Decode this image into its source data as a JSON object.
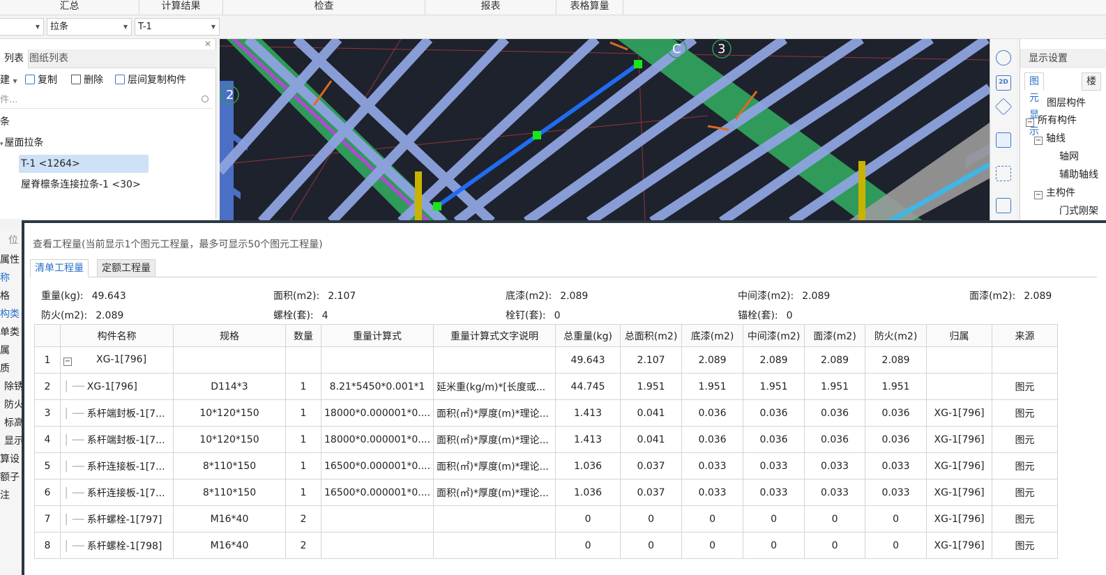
{
  "menubar": {
    "items": [
      "汇总",
      "计算结果",
      "检查",
      "报表",
      "表格算量"
    ]
  },
  "dropdowns": {
    "first": "",
    "second": "拉条",
    "third": "T-1"
  },
  "left_panel": {
    "tab_list": "列表",
    "tab_drawings": "图纸列表",
    "toolbar": {
      "new": "建",
      "copy": "复制",
      "delete": "删除",
      "floor_copy": "层间复制构件"
    },
    "search_placeholder": "件...",
    "tree": {
      "root": "条",
      "group": "屋面拉条",
      "item1": "T-1 <1264>",
      "item2": "屋脊檩条连接拉条-1 <30>"
    }
  },
  "viewport": {
    "axis_c": "C",
    "axis_3": "3",
    "axis_2": "2"
  },
  "display_panel": {
    "title": "显示设置",
    "tab_elements": "图元显示",
    "tab_floor": "楼",
    "tree": {
      "layer": "图层构件",
      "all": "所有构件",
      "axis": "轴线",
      "grid": "轴网",
      "aux": "辅助轴线",
      "main": "主构件",
      "frame": "门式刚架"
    }
  },
  "sidebar_labels": [
    "属性",
    "称",
    "格",
    "构类",
    "单类",
    "属",
    "质",
    "除锈",
    "防火",
    "标高",
    "显示",
    "算设",
    "额子",
    "注"
  ],
  "side_tab": "位",
  "dialog": {
    "title": "查看工程量(当前显示1个图元工程量，最多可显示50个图元工程量)",
    "tab_bill": "清单工程量",
    "tab_quota": "定额工程量",
    "summary": {
      "weight_label": "重量(kg):",
      "weight": "49.643",
      "area_label": "面积(m2):",
      "area": "2.107",
      "primer_label": "底漆(m2):",
      "primer": "2.089",
      "mid_label": "中间漆(m2):",
      "mid": "2.089",
      "top_label": "面漆(m2):",
      "top": "2.089",
      "fire_label": "防火(m2):",
      "fire": "2.089",
      "bolt_label": "螺栓(套):",
      "bolt": "4",
      "stud_label": "栓钉(套):",
      "stud": "0",
      "anchor_label": "锚栓(套):",
      "anchor": "0"
    },
    "table": {
      "headers": [
        "",
        "构件名称",
        "规格",
        "数量",
        "重量计算式",
        "重量计算式文字说明",
        "总重量(kg)",
        "总面积(m2)",
        "底漆(m2)",
        "中间漆(m2)",
        "面漆(m2)",
        "防火(m2)",
        "归属",
        "来源"
      ],
      "rows": [
        [
          "1",
          "XG-1[796]",
          "",
          "",
          "",
          "",
          "49.643",
          "2.107",
          "2.089",
          "2.089",
          "2.089",
          "2.089",
          "",
          ""
        ],
        [
          "2",
          "XG-1[796]",
          "D114*3",
          "1",
          "8.21*5450*0.001*1",
          "延米重(kg/m)*[长度或...",
          "44.745",
          "1.951",
          "1.951",
          "1.951",
          "1.951",
          "1.951",
          "",
          "图元"
        ],
        [
          "3",
          "系杆端封板-1[7...",
          "10*120*150",
          "1",
          "18000*0.000001*0....",
          "面积(㎡)*厚度(m)*理论...",
          "1.413",
          "0.041",
          "0.036",
          "0.036",
          "0.036",
          "0.036",
          "XG-1[796]",
          "图元"
        ],
        [
          "4",
          "系杆端封板-1[7...",
          "10*120*150",
          "1",
          "18000*0.000001*0....",
          "面积(㎡)*厚度(m)*理论...",
          "1.413",
          "0.041",
          "0.036",
          "0.036",
          "0.036",
          "0.036",
          "XG-1[796]",
          "图元"
        ],
        [
          "5",
          "系杆连接板-1[7...",
          "8*110*150",
          "1",
          "16500*0.000001*0....",
          "面积(㎡)*厚度(m)*理论...",
          "1.036",
          "0.037",
          "0.033",
          "0.033",
          "0.033",
          "0.033",
          "XG-1[796]",
          "图元"
        ],
        [
          "6",
          "系杆连接板-1[7...",
          "8*110*150",
          "1",
          "16500*0.000001*0....",
          "面积(㎡)*厚度(m)*理论...",
          "1.036",
          "0.037",
          "0.033",
          "0.033",
          "0.033",
          "0.033",
          "XG-1[796]",
          "图元"
        ],
        [
          "7",
          "系杆螺栓-1[797]",
          "M16*40",
          "2",
          "",
          "",
          "0",
          "0",
          "0",
          "0",
          "0",
          "0",
          "XG-1[796]",
          "图元"
        ],
        [
          "8",
          "系杆螺栓-1[798]",
          "M16*40",
          "2",
          "",
          "",
          "0",
          "0",
          "0",
          "0",
          "0",
          "0",
          "XG-1[796]",
          "图元"
        ]
      ]
    }
  }
}
